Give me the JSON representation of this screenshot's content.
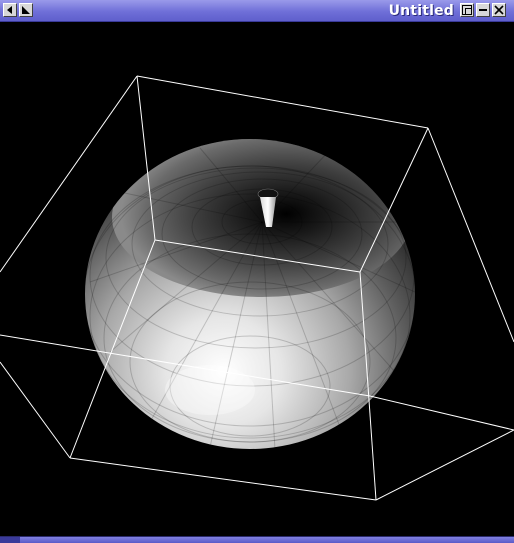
{
  "window": {
    "title": "Untitled"
  },
  "titlebar": {
    "left_buttons": [
      {
        "icon": "arrow-left-icon"
      },
      {
        "icon": "arrow-diagonal-icon"
      }
    ],
    "right_buttons": [
      {
        "icon": "restore-icon"
      },
      {
        "icon": "minimize-icon"
      },
      {
        "icon": "close-icon"
      }
    ]
  },
  "scene": {
    "background": "#000000",
    "object": "shaded-apple-model",
    "bounding_box_color": "#ffffff"
  },
  "colors": {
    "titlebar": "#7070d8",
    "titlebar_text": "#ffffff",
    "button_face": "#d8d8d8"
  }
}
